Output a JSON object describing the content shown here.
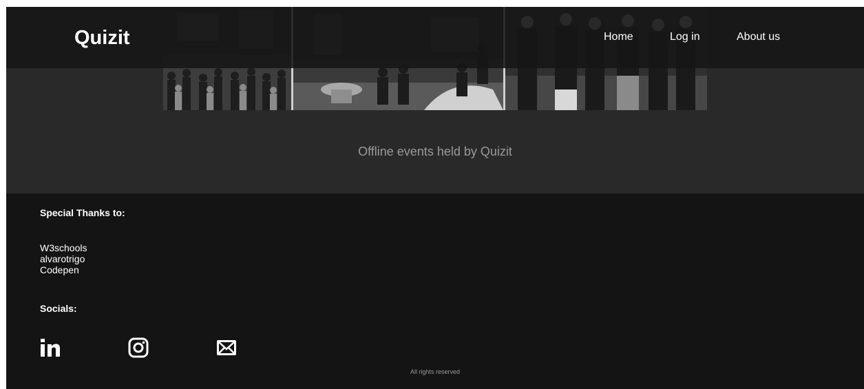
{
  "header": {
    "brand": "Quizit",
    "nav": {
      "home": "Home",
      "login": "Log in",
      "about": "About us"
    }
  },
  "hero": {
    "caption": "Offline events held by Quizit",
    "colors": {
      "background": "#292929",
      "photo_border": "#cfcfcf"
    }
  },
  "footer": {
    "thanks_title": "Special Thanks to:",
    "thanks": [
      "W3schools",
      "alvarotrigo",
      "Codepen"
    ],
    "socials_title": "Socials:",
    "socials": [
      {
        "icon": "linkedin-icon"
      },
      {
        "icon": "instagram-icon"
      },
      {
        "icon": "mail-icon"
      }
    ],
    "rights": "All rights reserved",
    "colors": {
      "background": "#141414",
      "muted_text": "#9a9a9a"
    }
  }
}
